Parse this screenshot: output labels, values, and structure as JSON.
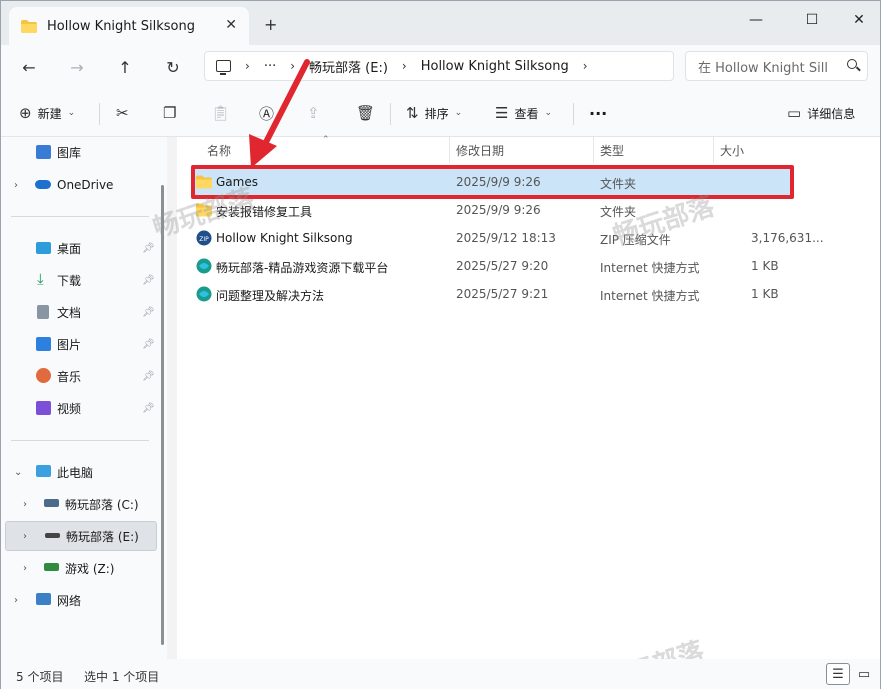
{
  "titlebar": {
    "tab_title": "Hollow Knight Silksong",
    "close_tab": "✕",
    "new_tab": "+",
    "minimize": "—",
    "maximize": "☐",
    "close": "✕"
  },
  "address": {
    "more": "···",
    "crumbs": [
      "畅玩部落 (E:)",
      "Hollow Knight Silksong"
    ],
    "search_placeholder": "在 Hollow Knight Sill"
  },
  "commands": {
    "new": "新建",
    "sort": "排序",
    "view": "查看",
    "more": "···",
    "details": "详细信息"
  },
  "sidebar": {
    "gallery": "图库",
    "onedrive": "OneDrive",
    "quick": [
      {
        "label": "桌面"
      },
      {
        "label": "下载"
      },
      {
        "label": "文档"
      },
      {
        "label": "图片"
      },
      {
        "label": "音乐"
      },
      {
        "label": "视频"
      }
    ],
    "this_pc": "此电脑",
    "drives": [
      {
        "label": "畅玩部落 (C:)"
      },
      {
        "label": "畅玩部落 (E:)"
      },
      {
        "label": "游戏 (Z:)"
      }
    ],
    "network": "网络"
  },
  "columns": {
    "name": "名称",
    "date": "修改日期",
    "type": "类型",
    "size": "大小"
  },
  "files": [
    {
      "name": "Games",
      "date": "2025/9/9 9:26",
      "type": "文件夹",
      "size": "",
      "icon": "folder-icon"
    },
    {
      "name": "安装报错修复工具",
      "date": "2025/9/9 9:26",
      "type": "文件夹",
      "size": "",
      "icon": "folder-icon"
    },
    {
      "name": "Hollow Knight Silksong",
      "date": "2025/9/12 18:13",
      "type": "ZIP 压缩文件",
      "size": "3,176,631...",
      "icon": "zip-icon"
    },
    {
      "name": "畅玩部落-精品游戏资源下载平台",
      "date": "2025/5/27 9:20",
      "type": "Internet 快捷方式",
      "size": "1 KB",
      "icon": "internet-shortcut-icon"
    },
    {
      "name": "问题整理及解决方法",
      "date": "2025/5/27 9:21",
      "type": "Internet 快捷方式",
      "size": "1 KB",
      "icon": "internet-shortcut-icon"
    }
  ],
  "status": {
    "count": "5 个项目",
    "selected": "选中 1 个项目"
  },
  "watermark": "畅玩部落",
  "colors": {
    "highlight": "#e0262e",
    "selection": "#cce4f7",
    "folder": "#f4c542"
  }
}
